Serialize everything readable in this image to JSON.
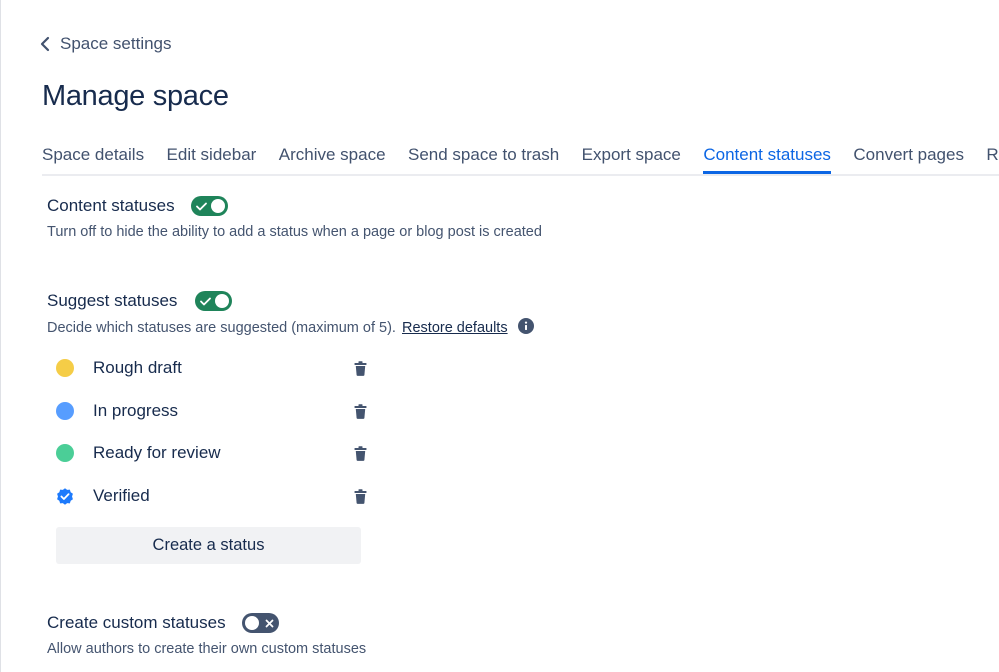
{
  "back": {
    "label": "Space settings"
  },
  "page": {
    "title": "Manage space"
  },
  "tabs": [
    {
      "label": "Space details"
    },
    {
      "label": "Edit sidebar"
    },
    {
      "label": "Archive space"
    },
    {
      "label": "Send space to trash"
    },
    {
      "label": "Export space"
    },
    {
      "label": "Content statuses",
      "active": true
    },
    {
      "label": "Convert pages"
    },
    {
      "label": "Relat"
    }
  ],
  "content_statuses": {
    "title": "Content statuses",
    "toggle": "on",
    "description": "Turn off to hide the ability to add a status when a page or blog post is created"
  },
  "suggest_statuses": {
    "title": "Suggest statuses",
    "toggle": "on",
    "description": "Decide which statuses are suggested (maximum of 5).",
    "restore_label": "Restore defaults",
    "info_icon": "info-icon"
  },
  "statuses": [
    {
      "name": "Rough draft",
      "color": "#f5cd47",
      "icon": "dot"
    },
    {
      "name": "In progress",
      "color": "#579dff",
      "icon": "dot"
    },
    {
      "name": "Ready for review",
      "color": "#4bce97",
      "icon": "dot"
    },
    {
      "name": "Verified",
      "color": "#1d7afc",
      "icon": "verified-badge-icon"
    }
  ],
  "create_button": {
    "label": "Create a status"
  },
  "custom_statuses": {
    "title": "Create custom statuses",
    "toggle": "off",
    "description": "Allow authors to create their own custom statuses"
  },
  "colors": {
    "toggle_on": "#1f845a",
    "toggle_off": "#44546f",
    "active_tab": "#0c66e4"
  }
}
